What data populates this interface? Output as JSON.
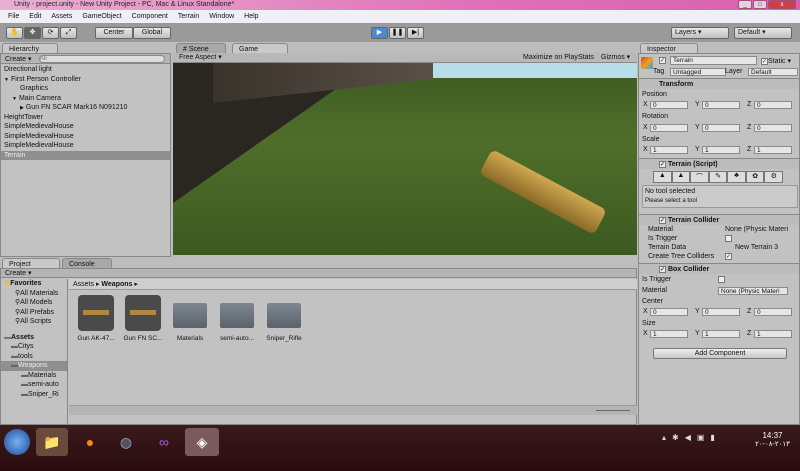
{
  "window": {
    "title": "Unity - project.unity - New Unity Project - PC, Mac & Linux Standalone*"
  },
  "menu": [
    "File",
    "Edit",
    "Assets",
    "GameObject",
    "Component",
    "Terrain",
    "Window",
    "Help"
  ],
  "toolbar": {
    "center": "Center",
    "global": "Global",
    "layers": "Layers",
    "layout": "Default"
  },
  "hierarchy": {
    "tab": "Hierarchy",
    "create": "Create",
    "search_placeholder": "All",
    "items": [
      {
        "label": "Directional light",
        "indent": 0
      },
      {
        "label": "First Person Controller",
        "indent": 0,
        "expander": "▼"
      },
      {
        "label": "Graphics",
        "indent": 2
      },
      {
        "label": "Main Camera",
        "indent": 1,
        "expander": "▼"
      },
      {
        "label": "Gun FN SCAR Mark16 N091210",
        "indent": 2,
        "expander": "▶"
      },
      {
        "label": "HeightTower",
        "indent": 0
      },
      {
        "label": "SimpleMedievalHouse",
        "indent": 0
      },
      {
        "label": "SimpleMedievalHouse",
        "indent": 0
      },
      {
        "label": "SimpleMedievalHouse",
        "indent": 0
      },
      {
        "label": "Terrain",
        "indent": 0,
        "selected": true
      }
    ]
  },
  "game": {
    "tab_scene": "Scene",
    "tab_game": "Game",
    "aspect": "Free Aspect",
    "maximize": "Maximize on Play",
    "stats": "Stats",
    "gizmos": "Gizmos"
  },
  "project": {
    "tab": "Project",
    "console_tab": "Console",
    "create": "Create",
    "favorites": {
      "label": "Favorites",
      "items": [
        "All Materials",
        "All Models",
        "All Prefabs",
        "All Scripts"
      ]
    },
    "assets": {
      "label": "Assets",
      "items": [
        {
          "label": "Citys",
          "indent": 1
        },
        {
          "label": "tools",
          "indent": 1
        },
        {
          "label": "Weapons",
          "indent": 1,
          "selected": true
        },
        {
          "label": "Materials",
          "indent": 2
        },
        {
          "label": "semi-auto",
          "indent": 2
        },
        {
          "label": "Sniper_Ri",
          "indent": 2
        }
      ]
    },
    "breadcrumb": [
      "Assets",
      "Weapons"
    ],
    "grid": [
      {
        "label": "Gun AK-47...",
        "type": "model"
      },
      {
        "label": "Gun FN SC...",
        "type": "model"
      },
      {
        "label": "Materials",
        "type": "folder"
      },
      {
        "label": "semi-auto...",
        "type": "folder"
      },
      {
        "label": "Sniper_Rifle",
        "type": "folder"
      }
    ]
  },
  "inspector": {
    "tab": "Inspector",
    "name": "Terrain",
    "static": "Static",
    "tag_label": "Tag",
    "tag": "Untagged",
    "layer_label": "Layer",
    "layer": "Default",
    "transform": {
      "title": "Transform",
      "position_label": "Position",
      "rotation_label": "Rotation",
      "scale_label": "Scale",
      "position": [
        "0",
        "0",
        "0"
      ],
      "rotation": [
        "0",
        "0",
        "0"
      ],
      "scale": [
        "1",
        "1",
        "1"
      ]
    },
    "terrain_script": {
      "title": "Terrain (Script)",
      "msg1": "No tool selected",
      "msg2": "Please select a tool"
    },
    "terrain_collider": {
      "title": "Terrain Collider",
      "material_label": "Material",
      "material": "None (Physic Materi",
      "trigger_label": "Is Trigger",
      "data_label": "Terrain Data",
      "data": "New Terrain 3",
      "trees_label": "Create Tree Colliders"
    },
    "box_collider": {
      "title": "Box Collider",
      "trigger_label": "Is Trigger",
      "material_label": "Material",
      "material": "None (Physic Materi",
      "center_label": "Center",
      "size_label": "Size",
      "center": [
        "0",
        "0",
        "0"
      ],
      "size": [
        "1",
        "1",
        "1"
      ]
    },
    "add_component": "Add Component",
    "axes": [
      "X",
      "Y",
      "Z"
    ]
  },
  "taskbar": {
    "time": "14:37",
    "date": "٢٠١٣-٠٨-٢٠"
  }
}
